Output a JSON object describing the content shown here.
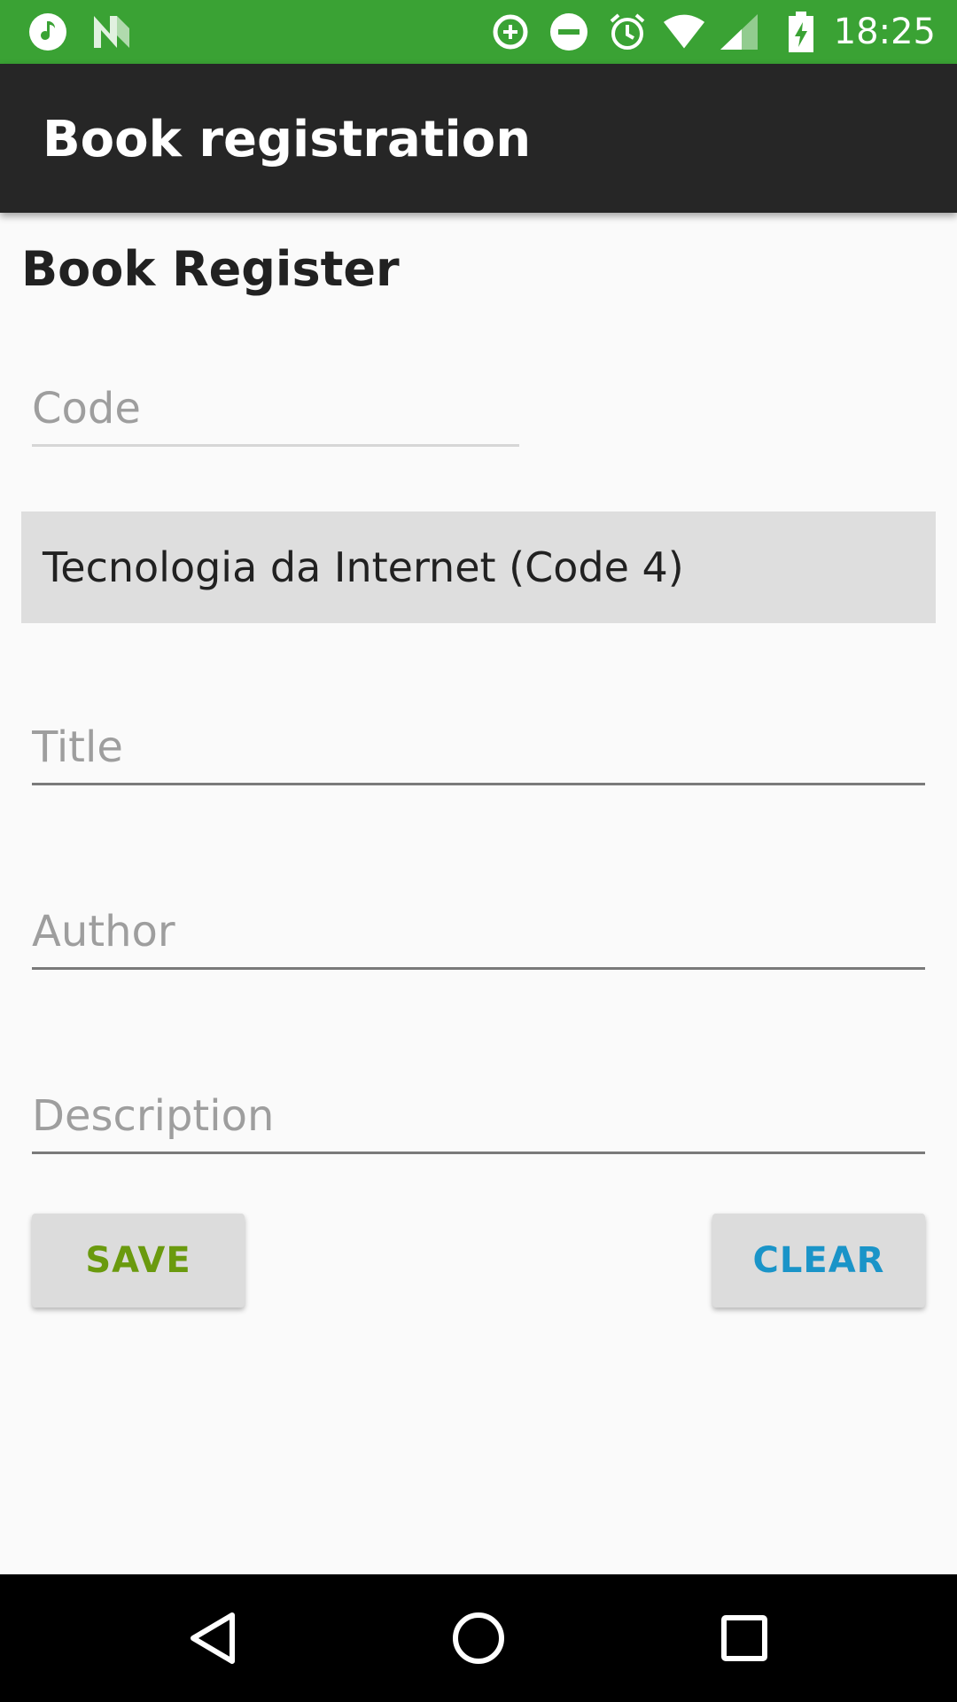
{
  "status_bar": {
    "time": "18:25",
    "icons": [
      "music-note-icon",
      "n-logo-icon",
      "data-saver-icon",
      "do-not-disturb-icon",
      "alarm-icon",
      "wifi-icon",
      "signal-icon",
      "battery-charging-icon"
    ],
    "color": "#3aa234"
  },
  "app_bar": {
    "title": "Book registration",
    "color": "#262626"
  },
  "form": {
    "heading": "Book Register",
    "code_placeholder": "Code",
    "code_value": "",
    "category_selected": "Tecnologia da Internet (Code 4)",
    "title_placeholder": "Title",
    "title_value": "",
    "author_placeholder": "Author",
    "author_value": "",
    "description_placeholder": "Description",
    "description_value": ""
  },
  "buttons": {
    "save_label": "SAVE",
    "save_color": "#6a9a0e",
    "clear_label": "CLEAR",
    "clear_color": "#1a94c8"
  },
  "nav_bar": {
    "icons": [
      "back-icon",
      "home-icon",
      "recents-icon"
    ]
  }
}
